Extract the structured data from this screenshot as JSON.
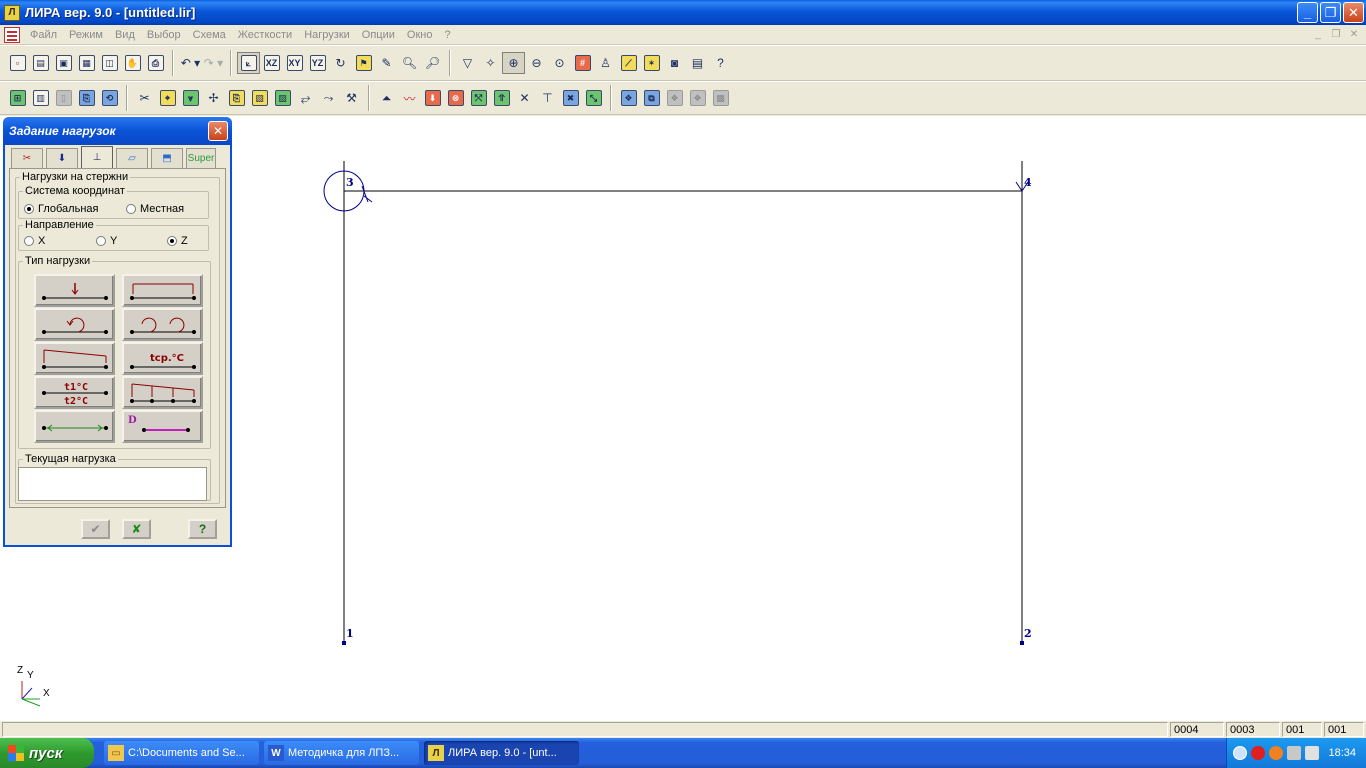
{
  "window": {
    "title": "ЛИРА  вер. 9.0 - [untitled.lir]",
    "app_icon": "lira-icon"
  },
  "menu": [
    "Файл",
    "Режим",
    "Вид",
    "Выбор",
    "Схема",
    "Жесткости",
    "Нагрузки",
    "Опции",
    "Окно",
    "?"
  ],
  "dialog": {
    "title": "Задание нагрузок",
    "tabs": [
      "scissors-icon",
      "node-load-icon",
      "bar-load-icon",
      "plate-load-icon",
      "body-load-icon",
      "Super"
    ],
    "group_main": "Нагрузки на стержни",
    "coord_system": {
      "label": "Система координат",
      "options": [
        "Глобальная",
        "Местная"
      ],
      "selected": "Глобальная"
    },
    "direction": {
      "label": "Направление",
      "options": [
        "X",
        "Y",
        "Z"
      ],
      "selected": "Z"
    },
    "load_type": {
      "label": "Тип нагрузки",
      "buttons": [
        {
          "name": "concentrated-force",
          "text": ""
        },
        {
          "name": "uniform-distributed",
          "text": ""
        },
        {
          "name": "concentrated-moment",
          "text": ""
        },
        {
          "name": "distributed-moment",
          "text": ""
        },
        {
          "name": "trapezoid-load",
          "text": ""
        },
        {
          "name": "avg-temperature",
          "text": "tср.°C"
        },
        {
          "name": "temperature-gradient",
          "text_top": "t1°C",
          "text_bottom": "t2°C"
        },
        {
          "name": "multi-trapezoid",
          "text": ""
        },
        {
          "name": "prestress",
          "text": ""
        },
        {
          "name": "dynamic-load",
          "text": "D"
        }
      ]
    },
    "current_load": {
      "label": "Текущая нагрузка",
      "value": ""
    }
  },
  "model": {
    "nodes": [
      {
        "id": "1"
      },
      {
        "id": "2"
      },
      {
        "id": "3"
      },
      {
        "id": "4"
      }
    ]
  },
  "axes": {
    "labels": [
      "Z",
      "Y",
      "X"
    ]
  },
  "statusbar": {
    "cells": [
      "0004",
      "0003",
      "001",
      "001"
    ]
  },
  "taskbar": {
    "start": "пуск",
    "tasks": [
      {
        "label": "C:\\Documents and Se...",
        "icon": "folder-icon",
        "active": false
      },
      {
        "label": "Методичка для ЛПЗ...",
        "icon": "word-icon",
        "active": false
      },
      {
        "label": "ЛИРА  вер. 9.0 - [unt...",
        "icon": "lira-icon",
        "active": true
      }
    ],
    "clock": "18:34"
  },
  "colors": {
    "accent": "#0a52d6",
    "model_line": "#000000",
    "node_label": "#00008b",
    "load_arrow": "#8b0000"
  }
}
